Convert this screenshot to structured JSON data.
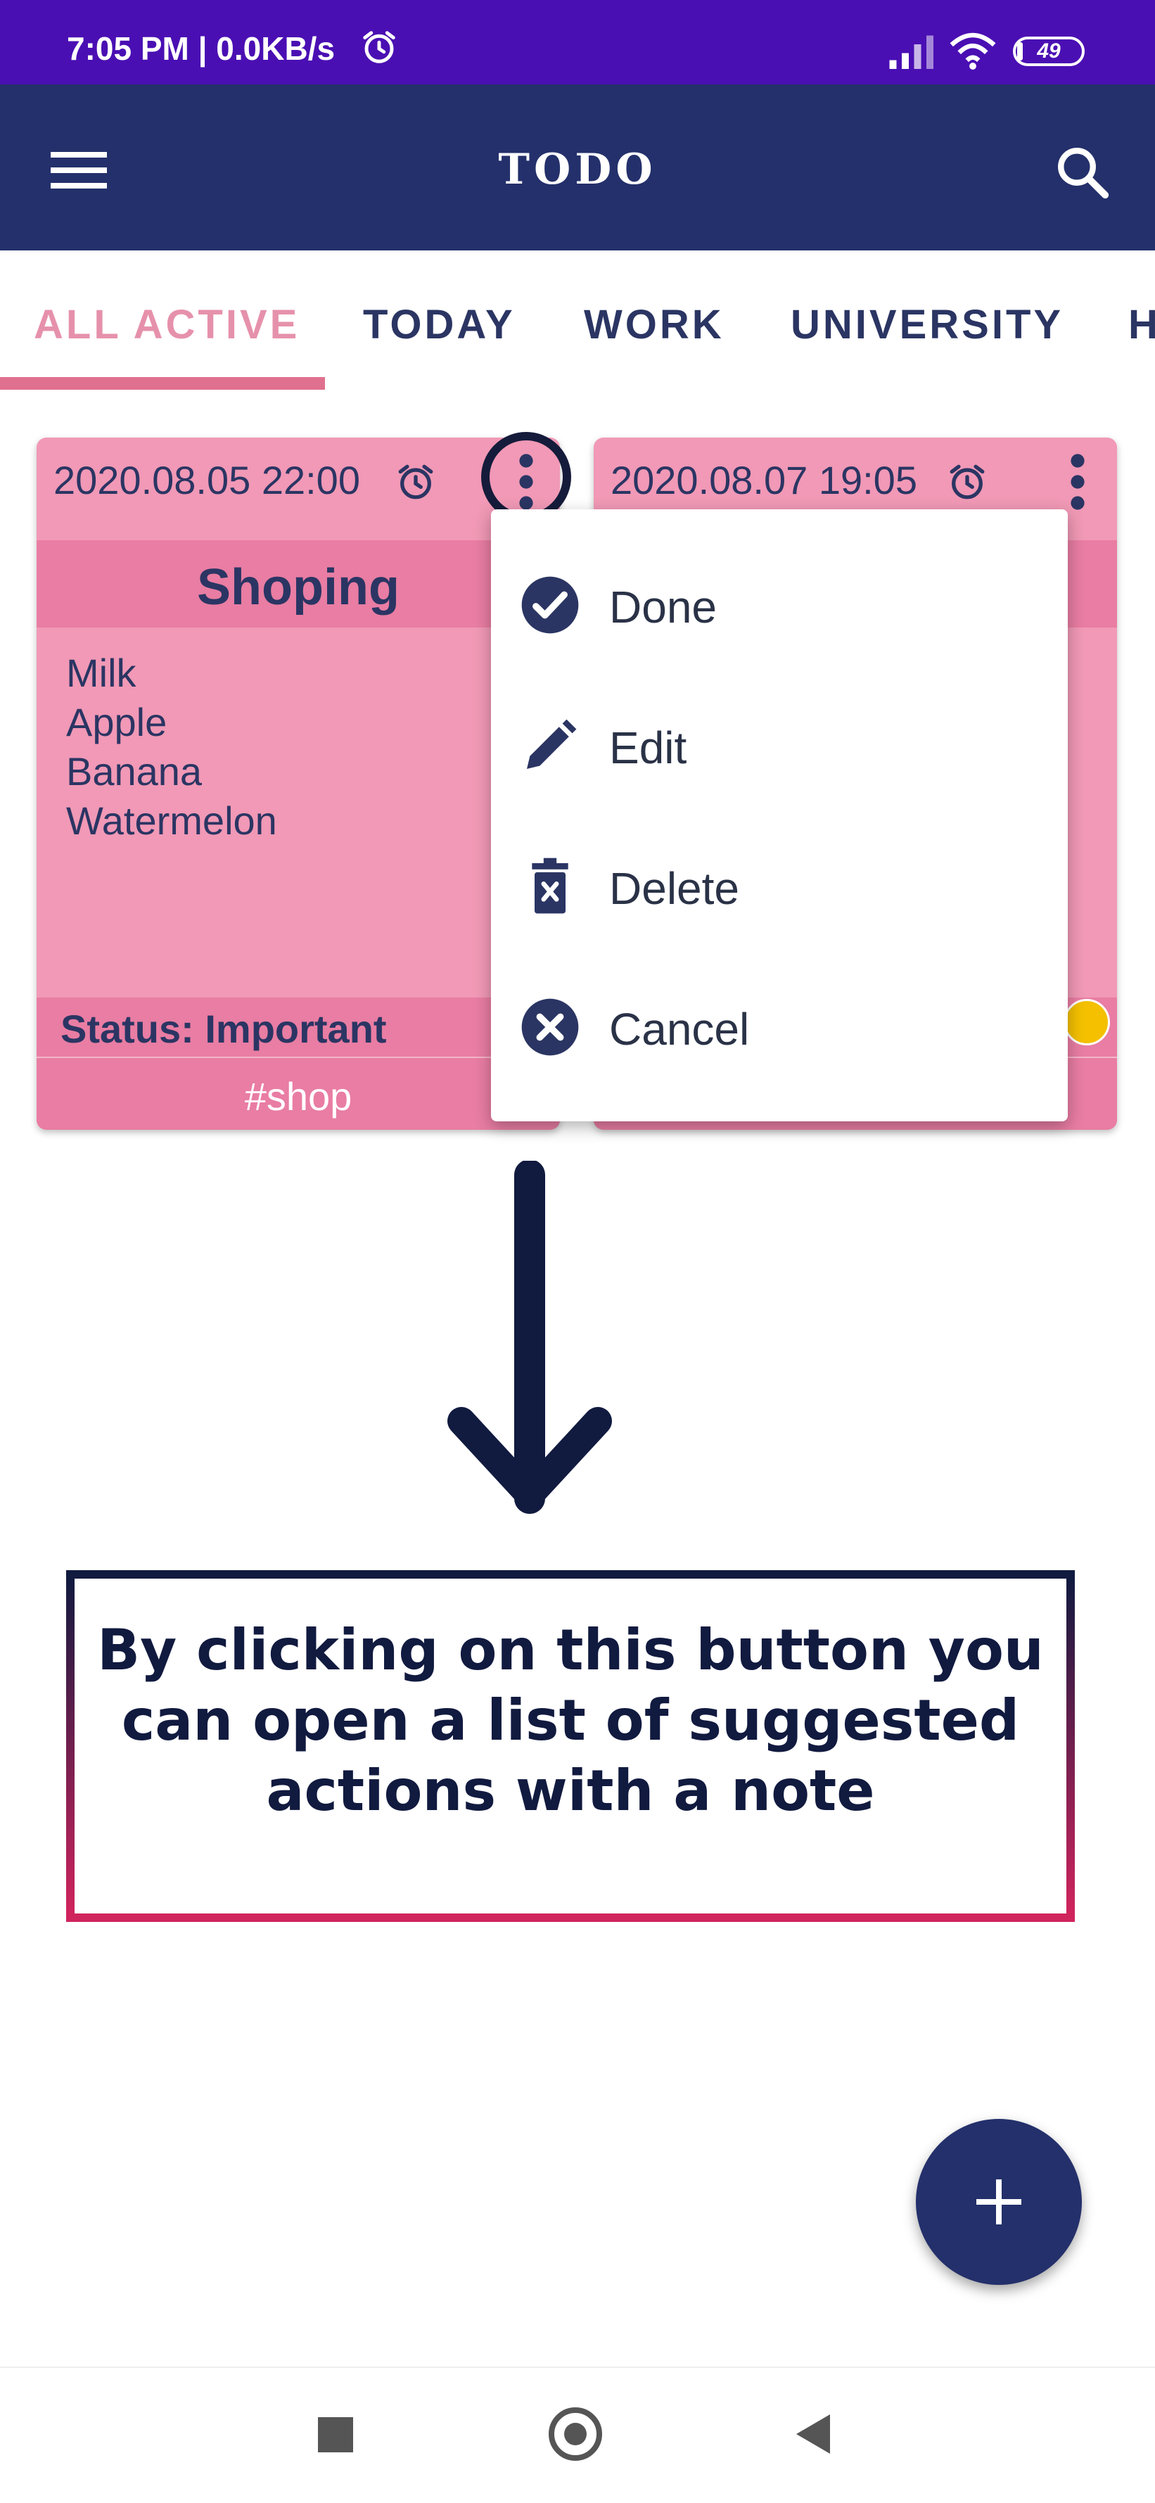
{
  "status_bar": {
    "time_text": "7:05 PM | 0.0KB/s",
    "battery": "49"
  },
  "app_bar": {
    "title": "TODO"
  },
  "tabs": [
    {
      "label": "ALL ACTIVE",
      "active": true
    },
    {
      "label": "TODAY",
      "active": false
    },
    {
      "label": "WORK",
      "active": false
    },
    {
      "label": "UNIVERSITY",
      "active": false
    },
    {
      "label": "H",
      "active": false
    }
  ],
  "cards": [
    {
      "datetime": "2020.08.05 22:00",
      "title": "Shoping",
      "items": [
        "Milk",
        "Apple",
        "Banana",
        "Watermelon"
      ],
      "status": "Status: Important",
      "tag": "#shop"
    },
    {
      "datetime": "2020.08.07 19:05",
      "priority_color": "#f4c000"
    }
  ],
  "popup_menu": {
    "items": [
      {
        "label": "Done",
        "icon": "check-circle-icon"
      },
      {
        "label": "Edit",
        "icon": "pencil-icon"
      },
      {
        "label": "Delete",
        "icon": "trash-icon"
      },
      {
        "label": "Cancel",
        "icon": "close-circle-icon"
      }
    ]
  },
  "annotation": {
    "note": "By clicking on this button you can open a list of suggested actions with a note"
  },
  "colors": {
    "status_bar": "#4a0fb3",
    "app_bar": "#24306b",
    "accent_pink": "#e0708f",
    "card": "#f199b6",
    "card_header": "#e97da3",
    "text_navy": "#2b3563"
  }
}
